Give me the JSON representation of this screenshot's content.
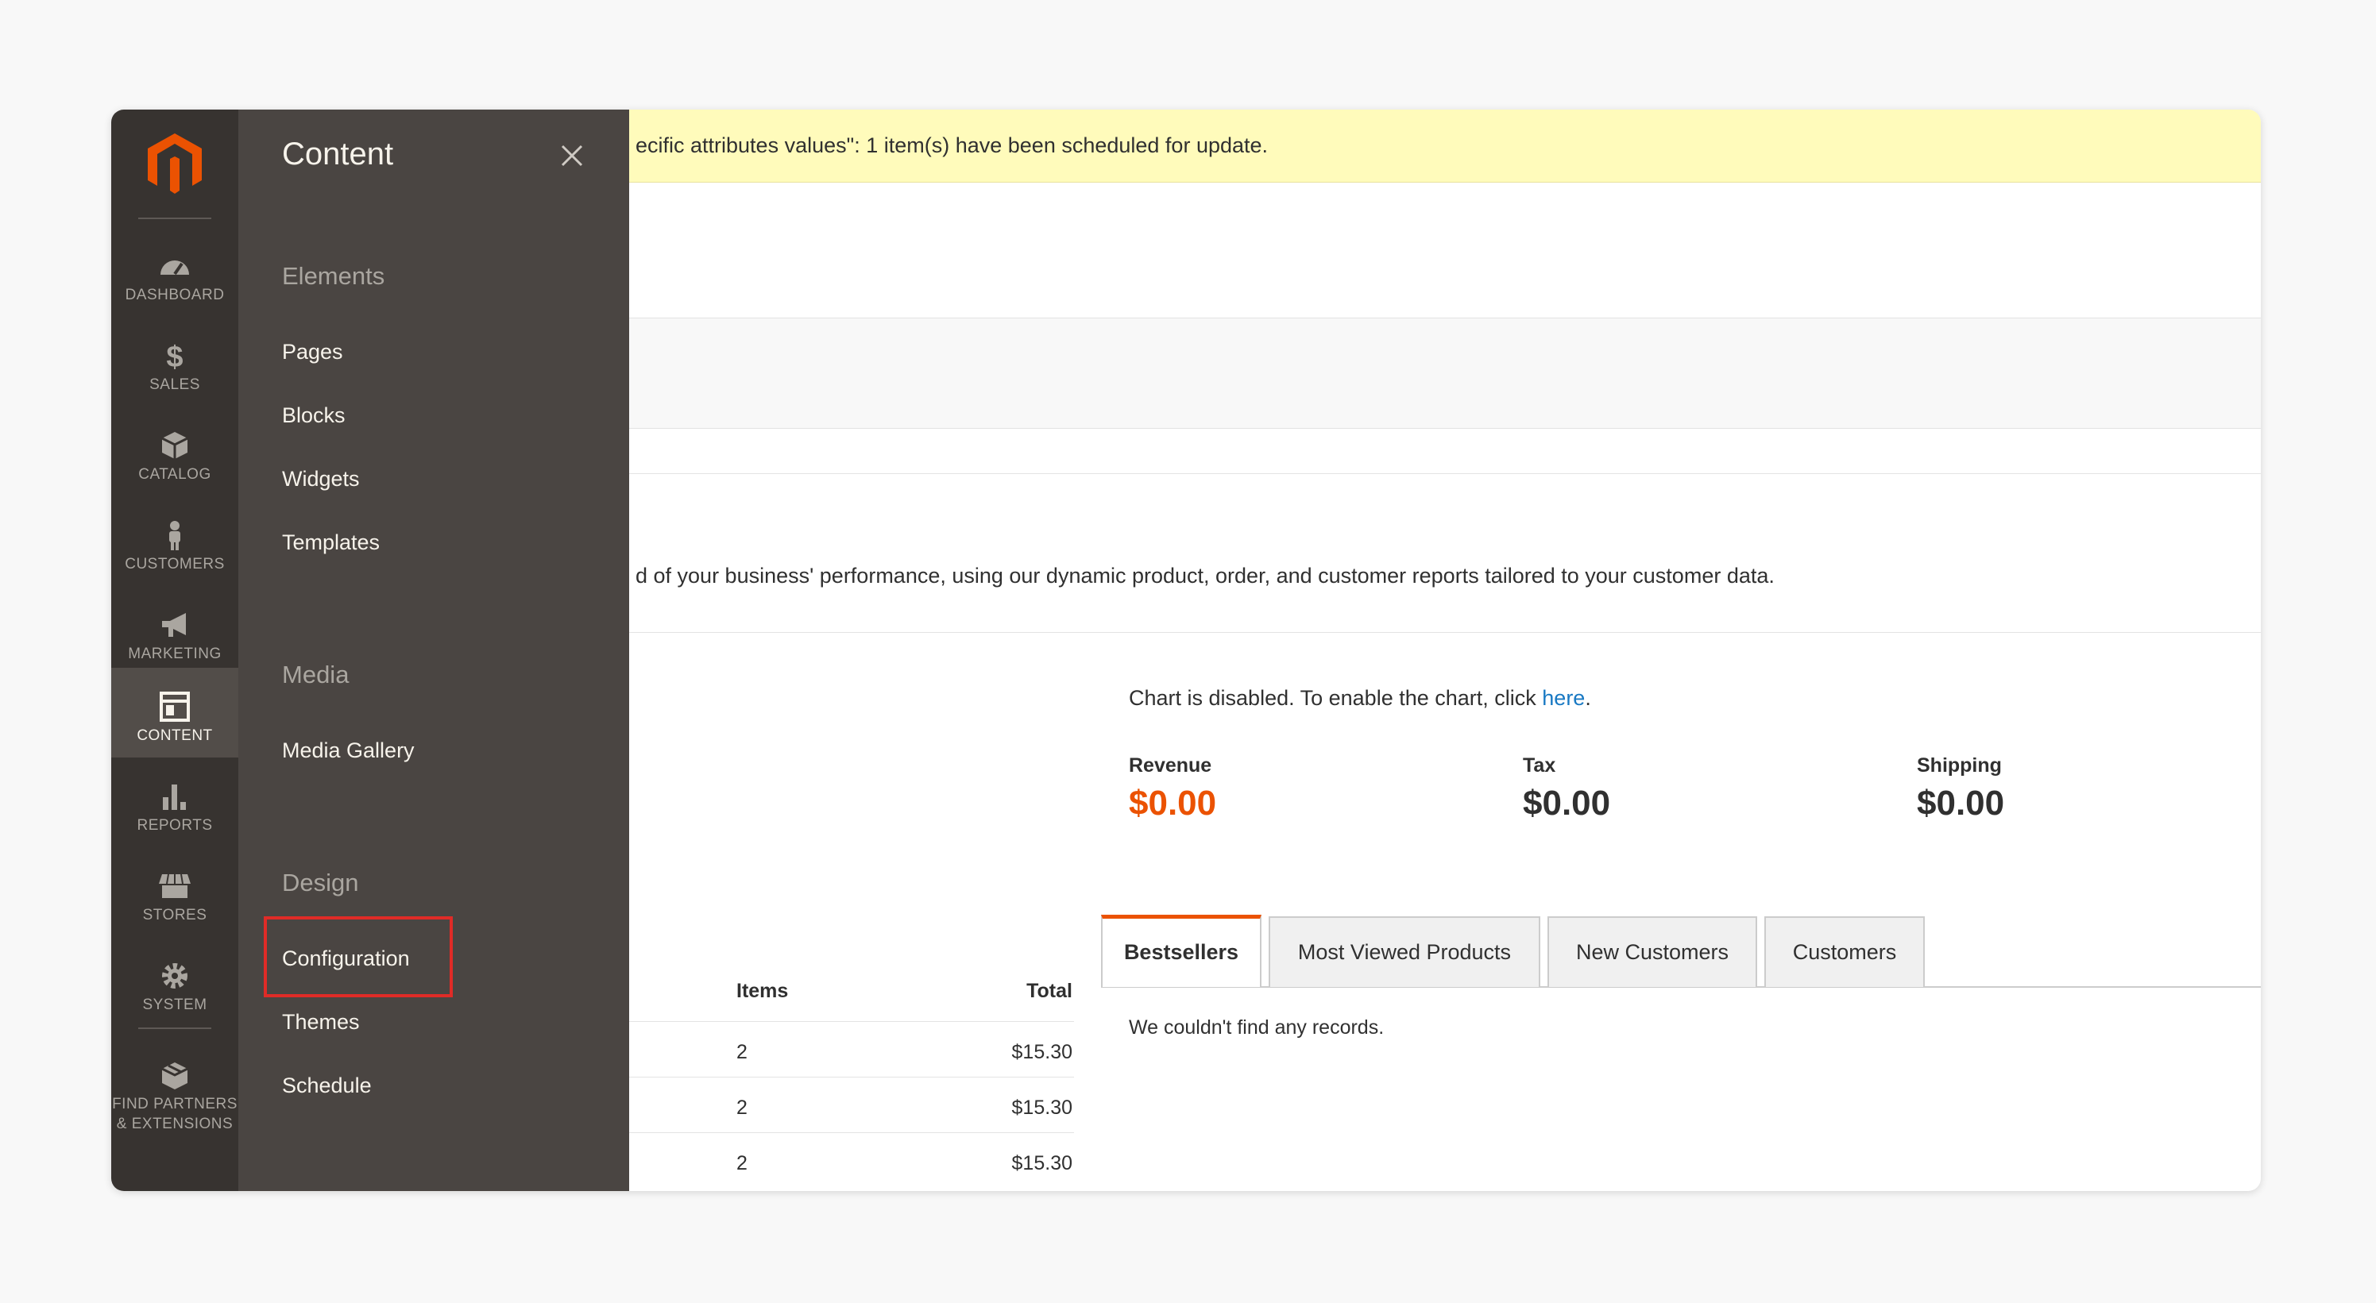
{
  "sidebar": {
    "items": [
      {
        "label": "Dashboard",
        "icon": "dashboard-icon",
        "active": false
      },
      {
        "label": "Sales",
        "icon": "dollar-icon",
        "active": false
      },
      {
        "label": "Catalog",
        "icon": "cube-icon",
        "active": false
      },
      {
        "label": "Customers",
        "icon": "person-icon",
        "active": false
      },
      {
        "label": "Marketing",
        "icon": "megaphone-icon",
        "active": false
      },
      {
        "label": "Content",
        "icon": "layout-icon",
        "active": true
      },
      {
        "label": "Reports",
        "icon": "bar-chart-icon",
        "active": false
      },
      {
        "label": "Stores",
        "icon": "storefront-icon",
        "active": false
      },
      {
        "label": "System",
        "icon": "gear-icon",
        "active": false
      }
    ],
    "find_partners": {
      "line1": "Find Partners",
      "line2": "& Extensions",
      "icon": "package-icon"
    }
  },
  "flyout": {
    "title": "Content",
    "sections": [
      {
        "title": "Elements",
        "items": [
          "Pages",
          "Blocks",
          "Widgets",
          "Templates"
        ]
      },
      {
        "title": "Media",
        "items": [
          "Media Gallery"
        ]
      },
      {
        "title": "Design",
        "items": [
          "Configuration",
          "Themes",
          "Schedule"
        ]
      }
    ],
    "highlighted_item": "Configuration"
  },
  "notice": {
    "text": "ecific attributes values\": 1 item(s) have been scheduled for update."
  },
  "intro": {
    "text": "d of your business' performance, using our dynamic product, order, and customer reports tailored to your customer data."
  },
  "chart_notice": {
    "text": "Chart is disabled. To enable the chart, click ",
    "link": "here",
    "suffix": "."
  },
  "totals": [
    {
      "label": "Revenue",
      "value": "$0.00"
    },
    {
      "label": "Tax",
      "value": "$0.00"
    },
    {
      "label": "Shipping",
      "value": "$0.00"
    }
  ],
  "orders_table": {
    "headers": {
      "items": "Items",
      "total": "Total"
    },
    "rows": [
      {
        "items": "2",
        "total": "$15.30"
      },
      {
        "items": "2",
        "total": "$15.30"
      },
      {
        "items": "2",
        "total": "$15.30"
      }
    ]
  },
  "tabs": [
    {
      "label": "Bestsellers",
      "active": true
    },
    {
      "label": "Most Viewed Products",
      "active": false
    },
    {
      "label": "New Customers",
      "active": false
    },
    {
      "label": "Customers",
      "active": false
    }
  ],
  "tab_content": {
    "empty": "We couldn't find any records."
  },
  "colors": {
    "accent": "#eb5202",
    "rail": "#373330",
    "flyout": "#4a4542",
    "link": "#1979c3",
    "highlight": "#e02b27",
    "notice": "#fffbbb"
  }
}
